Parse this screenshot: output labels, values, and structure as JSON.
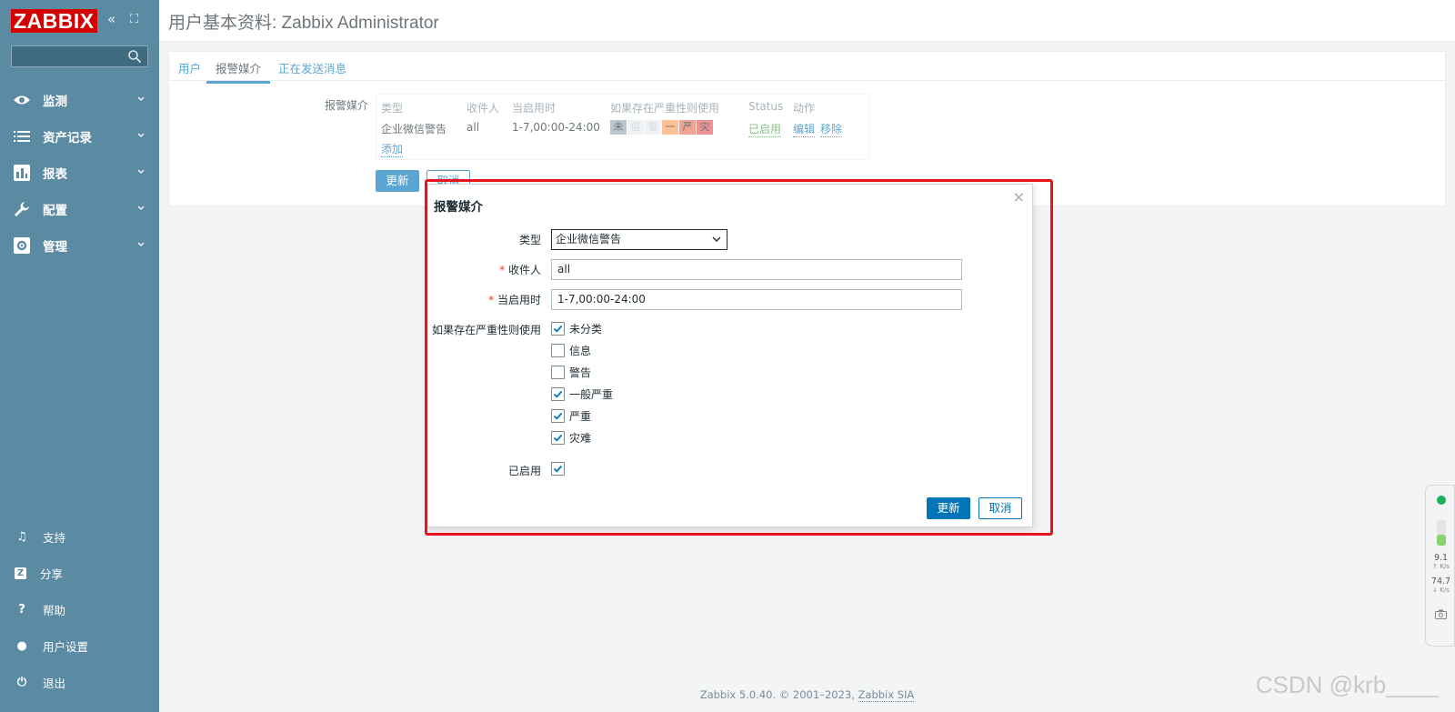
{
  "sidebar": {
    "logo": "ZABBIX",
    "collapse_glyph": "«",
    "kiosk_glyph": "⛶",
    "search_value": "",
    "nav": [
      {
        "label": "监测",
        "icon": "eye-icon"
      },
      {
        "label": "资产记录",
        "icon": "list-icon"
      },
      {
        "label": "报表",
        "icon": "bar-chart-icon"
      },
      {
        "label": "配置",
        "icon": "wrench-icon"
      },
      {
        "label": "管理",
        "icon": "gear-icon"
      }
    ],
    "footer_nav": [
      {
        "label": "支持",
        "glyph": "♫"
      },
      {
        "label": "分享",
        "glyph": "Z"
      },
      {
        "label": "帮助",
        "glyph": "?"
      },
      {
        "label": "用户设置",
        "glyph": "●"
      },
      {
        "label": "退出",
        "glyph": "⏻"
      }
    ]
  },
  "header": {
    "title": "用户基本资料: Zabbix Administrator"
  },
  "tabs": [
    "用户",
    "报警媒介",
    "正在发送消息"
  ],
  "active_tab": "报警媒介",
  "media_section": {
    "label": "报警媒介",
    "headers": {
      "type": "类型",
      "sendto": "收件人",
      "when": "当启用时",
      "severity": "如果存在严重性则使用",
      "status": "Status",
      "action": "动作"
    },
    "row": {
      "type": "企业微信警告",
      "sendto": "all",
      "when": "1-7,00:00-24:00",
      "severity": [
        {
          "label": "未",
          "color": "#97aab3",
          "active": true
        },
        {
          "label": "信",
          "color": "#e6edf0",
          "active": false
        },
        {
          "label": "警",
          "color": "#e6edf0",
          "active": false
        },
        {
          "label": "一",
          "color": "#ffa059",
          "active": true
        },
        {
          "label": "严",
          "color": "#e97659",
          "active": true
        },
        {
          "label": "灾",
          "color": "#e45959",
          "active": true
        }
      ],
      "status": "已启用",
      "edit": "编辑",
      "remove": "移除"
    },
    "add": "添加",
    "update_button": "更新",
    "cancel_button": "取消"
  },
  "dialog": {
    "title": "报警媒介",
    "close_glyph": "×",
    "type_label": "类型",
    "type_value": "企业微信警告",
    "sendto_label": "收件人",
    "sendto_value": "all",
    "when_label": "当启用时",
    "when_value": "1-7,00:00-24:00",
    "severity_label": "如果存在严重性则使用",
    "severities": [
      {
        "label": "未分类",
        "checked": true
      },
      {
        "label": "信息",
        "checked": false
      },
      {
        "label": "警告",
        "checked": false
      },
      {
        "label": "一般严重",
        "checked": true
      },
      {
        "label": "严重",
        "checked": true
      },
      {
        "label": "灾难",
        "checked": true
      }
    ],
    "enabled_label": "已启用",
    "enabled_checked": true,
    "update_button": "更新",
    "cancel_button": "取消",
    "required_mark": "*"
  },
  "footer": {
    "text": "Zabbix 5.0.40. © 2001–2023, ",
    "link": "Zabbix SIA"
  },
  "watermark": "CSDN @krb____",
  "net_widget": {
    "up": "9.1",
    "up_unit": "↑ K/s",
    "down": "74.7",
    "down_unit": "↓ K/s",
    "colors": {
      "status": "#16b45a",
      "bar": "#88d36a"
    }
  }
}
